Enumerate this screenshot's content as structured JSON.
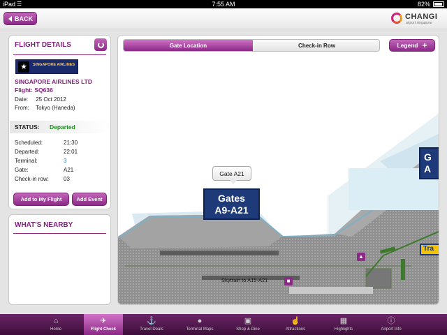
{
  "status_bar": {
    "device": "iPad",
    "time": "7:55 AM",
    "battery": "82%"
  },
  "header": {
    "back_label": "BACK",
    "logo_name": "CHANGI",
    "logo_tagline": "airport singapore"
  },
  "flight": {
    "title": "FLIGHT DETAILS",
    "airline_logo_text": "SINGAPORE AIRLINES",
    "airline": "SINGAPORE AIRLINES LTD",
    "flight_label": "Flight:",
    "flight_number": "SQ636",
    "date_label": "Date:",
    "date": "25 Oct 2012",
    "from_label": "From:",
    "from": "Tokyo (Haneda)",
    "status_label": "STATUS:",
    "status": "Departed",
    "status_color": "#1a8a1a",
    "rows": [
      {
        "label": "Scheduled:",
        "value": "21:30"
      },
      {
        "label": "Departed:",
        "value": "22:01"
      },
      {
        "label": "Terminal:",
        "value": "3"
      },
      {
        "label": "Gate:",
        "value": "A21"
      },
      {
        "label": "Check-in row:",
        "value": "03"
      }
    ],
    "add_flight_label": "Add to My Flight",
    "add_event_label": "Add Event"
  },
  "nearby": {
    "title": "WHAT'S NEARBY"
  },
  "map": {
    "tabs": [
      {
        "label": "Gate Location",
        "active": true
      },
      {
        "label": "Check-in Row",
        "active": false
      }
    ],
    "legend_label": "Legend",
    "gate_tooltip": "Gate A21",
    "gates_line1": "Gates",
    "gates_line2": "A9-A21",
    "side_line1": "G",
    "side_line2": "A",
    "transit_label": "Tra",
    "skytrain_label": "Skytrain to A15-A21"
  },
  "tabbar": {
    "items": [
      {
        "label": "Home",
        "icon": "home-icon",
        "selected": false
      },
      {
        "label": "Flight Check",
        "icon": "plane-icon",
        "selected": true
      },
      {
        "label": "Travel Deals",
        "icon": "deals-icon",
        "selected": false
      },
      {
        "label": "Terminal Maps",
        "icon": "map-pin-icon",
        "selected": false
      },
      {
        "label": "Shop & Dine",
        "icon": "shopping-bag-icon",
        "selected": false
      },
      {
        "label": "Attractions",
        "icon": "thumbs-up-icon",
        "selected": false
      },
      {
        "label": "Highlights",
        "icon": "highlights-icon",
        "selected": false
      },
      {
        "label": "Airport Info",
        "icon": "info-icon",
        "selected": false
      }
    ]
  },
  "colors": {
    "brand_purple": "#8b2a86",
    "gate_navy": "#1f3a78",
    "transit_yellow": "#f5c200"
  }
}
